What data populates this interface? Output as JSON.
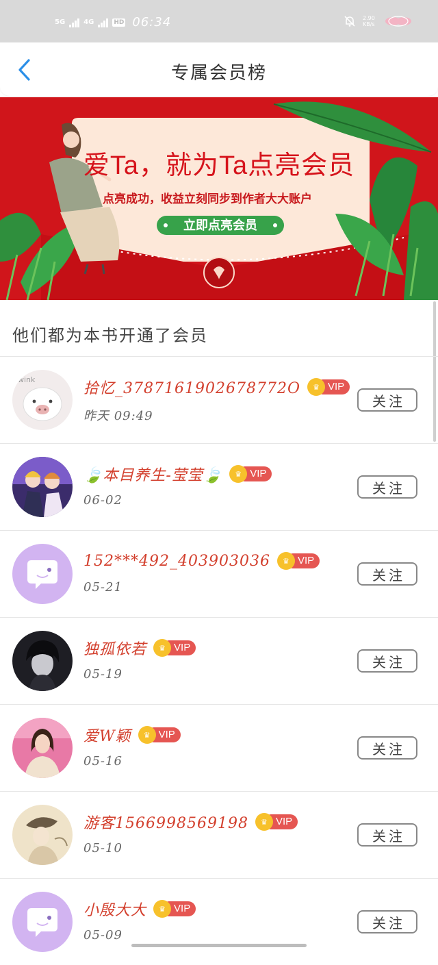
{
  "status_bar": {
    "time": "06:34",
    "network_1": "5G",
    "network_2": "4G",
    "hd": "HD",
    "speed": "2.90 KB/s",
    "colors": {
      "background": "#d9d9d9"
    }
  },
  "nav": {
    "back_icon": "chevron-left-icon",
    "title": "专属会员榜"
  },
  "banner": {
    "headline": "爱Ta，就为Ta点亮会员",
    "subtitle": "点亮成功，收益立刻同步到作者大大账户",
    "button_label": "立即点亮会员",
    "colors": {
      "background": "#d0151b",
      "card": "#fde8d9",
      "button": "#37a24a"
    }
  },
  "section": {
    "title": "他们都为本书开通了会员"
  },
  "members": [
    {
      "name": "拾忆_3787161902678772O",
      "time": "昨天 09:49",
      "badge": "VIP",
      "follow_label": "关注",
      "avatar": "pig-avatar"
    },
    {
      "name": "🍃本目养生-莹莹🍃",
      "time": "06-02",
      "badge": "VIP",
      "follow_label": "关注",
      "avatar": "anime-couple-avatar"
    },
    {
      "name": "152***492_403903036",
      "time": "05-21",
      "badge": "VIP",
      "follow_label": "关注",
      "avatar": "default-chat-avatar"
    },
    {
      "name": "独孤依若",
      "time": "05-19",
      "badge": "VIP",
      "follow_label": "关注",
      "avatar": "dark-anime-avatar"
    },
    {
      "name": "爱W颖",
      "time": "05-16",
      "badge": "VIP",
      "follow_label": "关注",
      "avatar": "woman-photo-avatar"
    },
    {
      "name": "游客1566998569198",
      "time": "05-10",
      "badge": "VIP",
      "follow_label": "关注",
      "avatar": "painting-avatar"
    },
    {
      "name": "小殷大大",
      "time": "05-09",
      "badge": "VIP",
      "follow_label": "关注",
      "avatar": "default-chat-avatar"
    }
  ],
  "colors": {
    "name": "#d3402e",
    "vip_crown": "#f7c12b",
    "vip_label": "#e55652",
    "default_avatar": "#d2b4f1"
  }
}
